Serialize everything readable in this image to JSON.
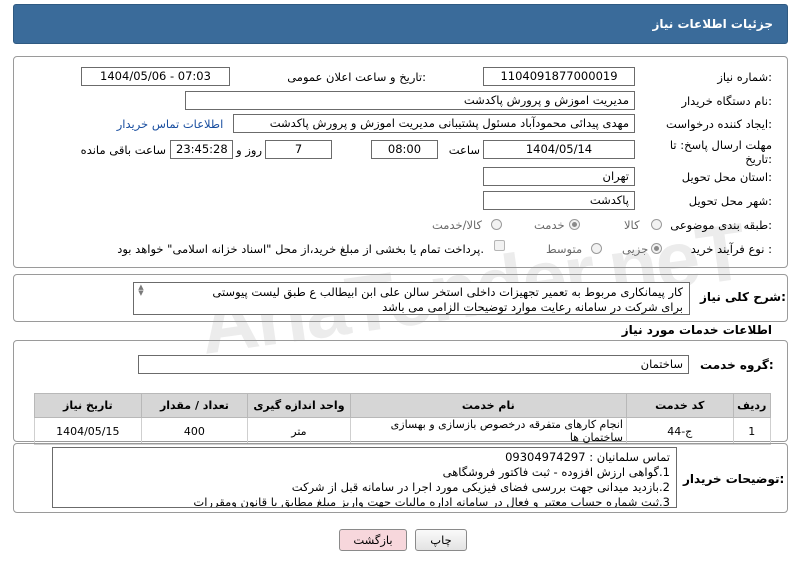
{
  "header": {
    "title": "جزئیات اطلاعات نیاز"
  },
  "form": {
    "need_number_label": "شماره نیاز:",
    "need_number": "1104091877000019",
    "announce_label": "تاریخ و ساعت اعلان عمومی:",
    "announce_value": "1404/05/06 - 07:03",
    "buyer_label": "نام دستگاه خریدار:",
    "buyer_value": "مدیریت اموزش و پرورش پاکدشت",
    "requester_label": "ایجاد کننده درخواست:",
    "requester_value": "مهدی پیدائی محمودآباد مسئول پشتیبانی مدیریت اموزش و پرورش پاکدشت",
    "contact_link": "اطلاعات تماس خریدار",
    "deadline_label": "مهلت ارسال پاسخ: تا تاریخ:",
    "deadline_date": "1404/05/14",
    "time_label": "ساعت",
    "deadline_time": "08:00",
    "days_value": "7",
    "days_label": "روز و",
    "remaining_time": "23:45:28",
    "remaining_label": "ساعت باقی مانده",
    "province_label": "استان محل تحویل:",
    "province_value": "تهران",
    "city_label": "شهر محل تحویل:",
    "city_value": "پاکدشت",
    "category_label": "طبقه بندی موضوعی:",
    "category_options": [
      "کالا",
      "خدمت",
      "کالا/خدمت"
    ],
    "category_selected": "خدمت",
    "process_label": "نوع فرآیند خرید :",
    "process_options": [
      "جزیی",
      "متوسط"
    ],
    "process_selected": "جزیی",
    "payment_note": "پرداخت تمام یا بخشی از مبلغ خرید،از محل \"اسناد خزانه اسلامی\" خواهد بود."
  },
  "description": {
    "label": "شرح کلی نیاز:",
    "text": "کار پیمانکاری مربوط به تعمیر تجهیزات داخلی استخر سالن علی ابن ابیطالب ع طبق لیست پیوستی\nبرای شرکت در سامانه رعایت موارد توضیحات الزامی می باشد"
  },
  "services": {
    "section_title": "اطلاعات خدمات مورد نیاز",
    "group_label": "گروه خدمت:",
    "group_value": "ساختمان",
    "columns": [
      "ردیف",
      "کد خدمت",
      "نام خدمت",
      "واحد اندازه گیری",
      "تعداد / مقدار",
      "تاریخ نیاز"
    ],
    "rows": [
      {
        "row": "1",
        "code": "ج-44",
        "name": "انجام کارهای متفرقه درخصوص بازسازی و بهسازی ساختمان ها",
        "unit": "متر",
        "qty": "400",
        "date": "1404/05/15"
      }
    ]
  },
  "buyer_notes": {
    "label": "توضیحات خریدار:",
    "text": "تماس سلمانیان : 09304974297\n1.گواهی ارزش افزوده - ثبت فاکتور فروشگاهی\n2.بازدید میدانی جهت بررسی فضای فیزیکی مورد اجرا در سامانه قبل از شرکت\n3.ثبت شماره حساب معتبر و فعال در سامانه اداره مالیات جهت واریز مبلغ مطابق با قانون ومقررات"
  },
  "buttons": {
    "print": "چاپ",
    "back": "بازگشت"
  },
  "watermark": "AriaTender.neT",
  "colors": {
    "header_bg": "#3a6b9a",
    "back_button_bg": "#f7d7dc",
    "link": "#1a4fa0"
  }
}
